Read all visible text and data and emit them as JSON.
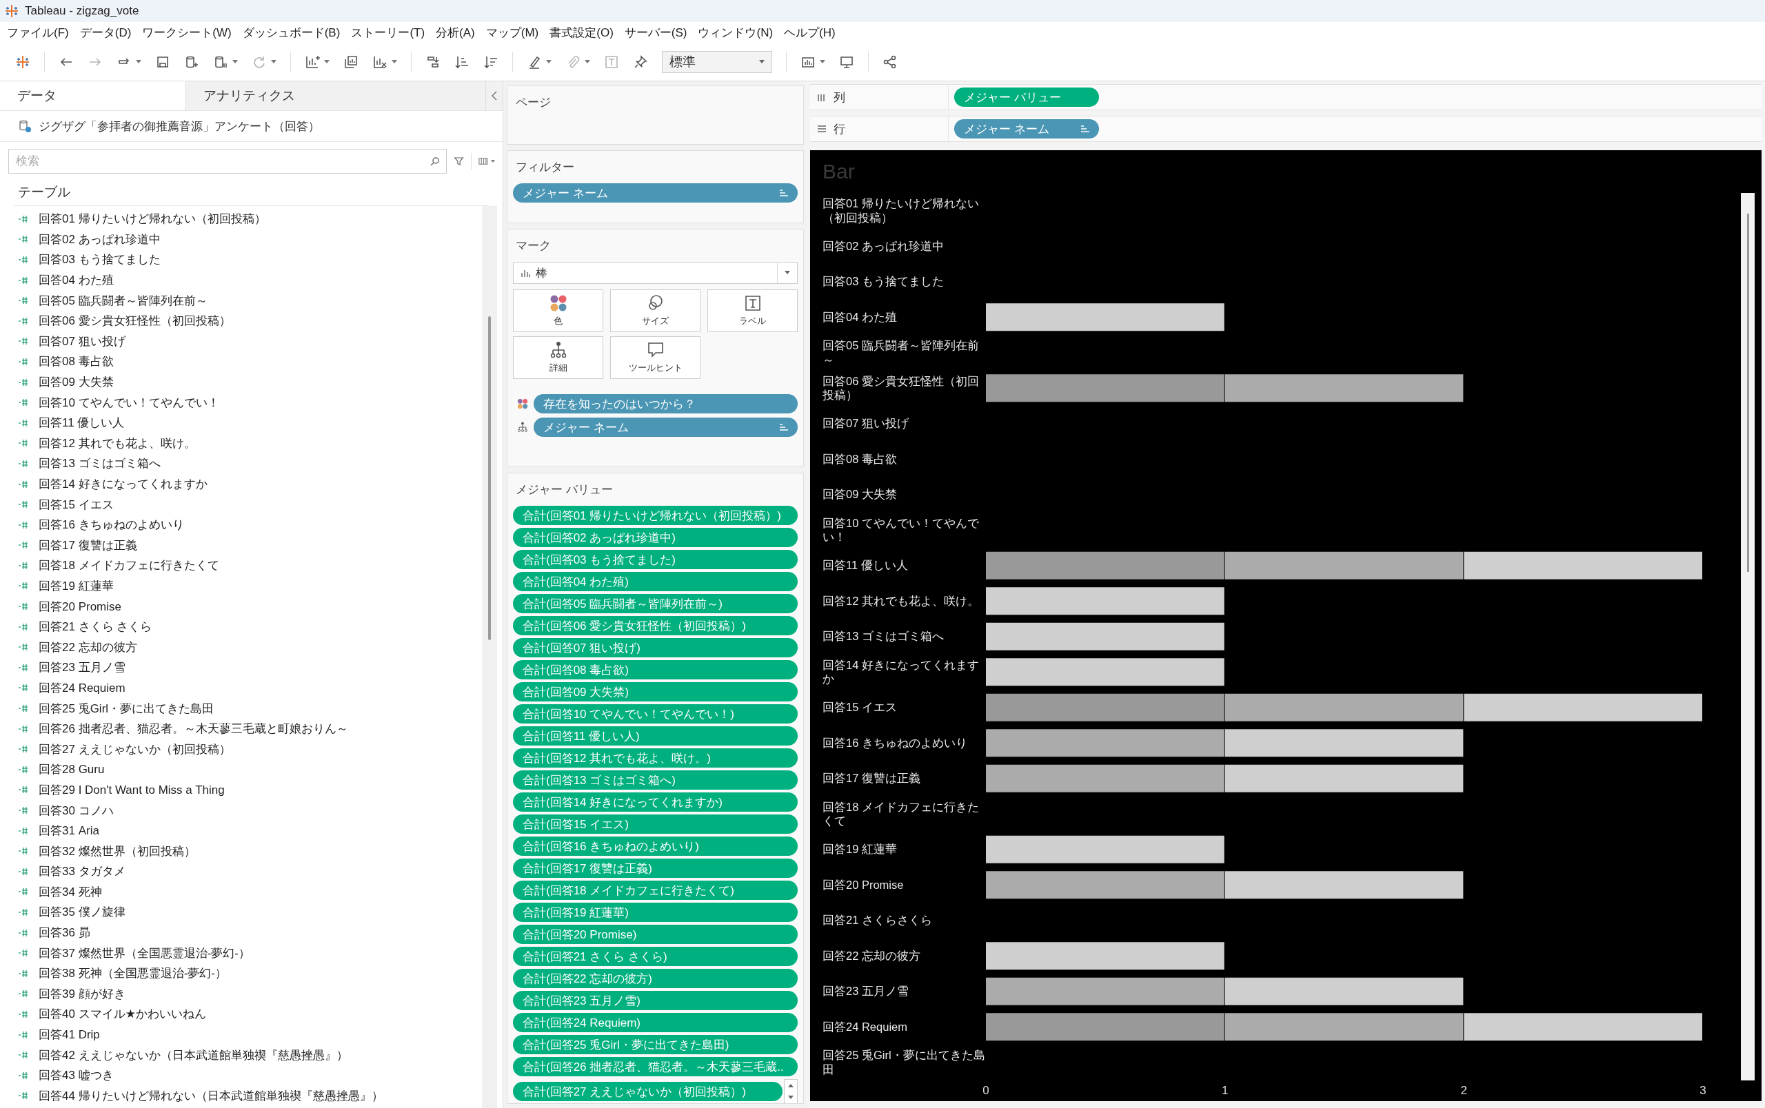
{
  "window": {
    "title": "Tableau - zigzag_vote"
  },
  "menu": [
    "ファイル(F)",
    "データ(D)",
    "ワークシート(W)",
    "ダッシュボード(B)",
    "ストーリー(T)",
    "分析(A)",
    "マップ(M)",
    "書式設定(O)",
    "サーバー(S)",
    "ウィンドウ(N)",
    "ヘルプ(H)"
  ],
  "toolbar": {
    "fit_dropdown": {
      "value": "標準"
    }
  },
  "data_pane": {
    "tabs": [
      {
        "label": "データ",
        "selected": true
      },
      {
        "label": "アナリティクス",
        "selected": false
      }
    ],
    "data_source": "ジグザグ「参拝者の御推薦音源」アンケート（回答）",
    "search": {
      "placeholder": "検索"
    },
    "section": "テーブル",
    "fields": [
      "回答01 帰りたいけど帰れない（初回投稿）",
      "回答02 あっぱれ珍道中",
      "回答03 もう捨てました",
      "回答04 わた殖",
      "回答05 臨兵闘者～皆陣列在前～",
      "回答06 愛シ貴女狂怪性（初回投稿）",
      "回答07 狙い投げ",
      "回答08 毒占欲",
      "回答09 大失禁",
      "回答10 てやんでい！てやんでい！",
      "回答11 優しい人",
      "回答12 其れでも花よ、咲け。",
      "回答13 ゴミはゴミ箱へ",
      "回答14 好きになってくれますか",
      "回答15 イエス",
      "回答16 きちゅねのよめいり",
      "回答17 復讐は正義",
      "回答18 メイドカフェに行きたくて",
      "回答19 紅蓮華",
      "回答20 Promise",
      "回答21 さくら さくら",
      "回答22 忘却の彼方",
      "回答23 五月ノ雪",
      "回答24 Requiem",
      "回答25 兎Girl・夢に出てきた島田",
      "回答26 拙者忍者、猫忍者。～木天蓼三毛蔵と町娘おりん～",
      "回答27 ええじゃないか（初回投稿）",
      "回答28 Guru",
      "回答29 I Don't Want to Miss a Thing",
      "回答30 コノハ",
      "回答31 Aria",
      "回答32 燦然世界（初回投稿）",
      "回答33 タガタメ",
      "回答34 死神",
      "回答35 僕ノ旋律",
      "回答36 昴",
      "回答37 燦然世界（全国悪霊退治-夢幻-）",
      "回答38 死神（全国悪霊退治-夢幻-）",
      "回答39 顔が好き",
      "回答40 スマイル★かわいいねん",
      "回答41 Drip",
      "回答42 ええじゃないか（日本武道館単独禊『慈愚挫愚』）",
      "回答43 嘘つき",
      "回答44 帰りたいけど帰れない（日本武道館単独禊『慈愚挫愚』）"
    ]
  },
  "pages_card": {
    "title": "ページ"
  },
  "filters_card": {
    "title": "フィルター",
    "pills": [
      {
        "label": "メジャー ネーム",
        "kind": "dimension",
        "sorted": true
      }
    ]
  },
  "marks_card": {
    "title": "マーク",
    "mark_type": "棒",
    "buttons": [
      {
        "label": "色",
        "kind": "color"
      },
      {
        "label": "サイズ",
        "kind": "size"
      },
      {
        "label": "ラベル",
        "kind": "label"
      },
      {
        "label": "詳細",
        "kind": "detail"
      },
      {
        "label": "ツールヒント",
        "kind": "tooltip"
      }
    ],
    "pills": [
      {
        "label": "存在を知ったのはいつから？",
        "kind": "color",
        "sorted": false
      },
      {
        "label": "メジャー ネーム",
        "kind": "detail",
        "sorted": true
      }
    ]
  },
  "measure_values_card": {
    "title": "メジャー バリュー",
    "pills": [
      "合計(回答01 帰りたいけど帰れない（初回投稿）)",
      "合計(回答02 あっぱれ珍道中)",
      "合計(回答03 もう捨てました)",
      "合計(回答04 わた殖)",
      "合計(回答05 臨兵闘者～皆陣列在前～)",
      "合計(回答06 愛シ貴女狂怪性（初回投稿）)",
      "合計(回答07 狙い投げ)",
      "合計(回答08 毒占欲)",
      "合計(回答09 大失禁)",
      "合計(回答10 てやんでい！てやんでい！)",
      "合計(回答11 優しい人)",
      "合計(回答12 其れでも花よ、咲け。)",
      "合計(回答13 ゴミはゴミ箱へ)",
      "合計(回答14 好きになってくれますか)",
      "合計(回答15 イエス)",
      "合計(回答16 きちゅねのよめいり)",
      "合計(回答17 復讐は正義)",
      "合計(回答18 メイドカフェに行きたくて)",
      "合計(回答19 紅蓮華)",
      "合計(回答20 Promise)",
      "合計(回答21 さくら さくら)",
      "合計(回答22 忘却の彼方)",
      "合計(回答23 五月ノ雪)",
      "合計(回答24 Requiem)",
      "合計(回答25 兎Girl・夢に出てきた島田)",
      "合計(回答26 拙者忍者、猫忍者。～木天蓼三毛蔵..",
      "合計(回答27 ええじゃないか（初回投稿）)"
    ]
  },
  "shelves": [
    {
      "label": "列",
      "kind": "columns",
      "pill": {
        "label": "メジャー バリュー",
        "kind": "measure",
        "sorted": false
      }
    },
    {
      "label": "行",
      "kind": "rows",
      "pill": {
        "label": "メジャー ネーム",
        "kind": "dimension",
        "sorted": true
      }
    }
  ],
  "view": {
    "chart_data": {
      "type": "bar",
      "title": "Bar",
      "orientation": "horizontal",
      "stacked": true,
      "categories": [
        "回答01 帰りたいけど帰れない（初回投稿）",
        "回答02 あっぱれ珍道中",
        "回答03 もう捨てました",
        "回答04 わた殖",
        "回答05 臨兵闘者～皆陣列在前～",
        "回答06 愛シ貴女狂怪性（初回投稿）",
        "回答07 狙い投げ",
        "回答08 毒占欲",
        "回答09 大失禁",
        "回答10 てやんでい！てやんでい！",
        "回答11 優しい人",
        "回答12 其れでも花よ、咲け。",
        "回答13 ゴミはゴミ箱へ",
        "回答14 好きになってくれますか",
        "回答15 イエス",
        "回答16 きちゅねのよめいり",
        "回答17 復讐は正義",
        "回答18 メイドカフェに行きたくて",
        "回答19 紅蓮華",
        "回答20 Promise",
        "回答21 さくらさくら",
        "回答22 忘却の彼方",
        "回答23 五月ノ雪",
        "回答24 Requiem",
        "回答25 兎Girl・夢に出てきた島田"
      ],
      "series": [
        {
          "color": "#999999",
          "values": [
            null,
            null,
            null,
            null,
            null,
            1,
            null,
            null,
            null,
            null,
            1,
            null,
            null,
            null,
            1,
            null,
            null,
            null,
            null,
            null,
            null,
            null,
            null,
            1,
            null
          ]
        },
        {
          "color": "#ababab",
          "values": [
            null,
            null,
            null,
            null,
            null,
            1,
            null,
            null,
            null,
            null,
            1,
            null,
            null,
            null,
            1,
            1,
            1,
            null,
            null,
            1,
            null,
            null,
            1,
            1,
            null
          ]
        },
        {
          "color": "#cfcfcf",
          "values": [
            null,
            null,
            null,
            1,
            null,
            null,
            null,
            null,
            null,
            null,
            1,
            1,
            1,
            1,
            1,
            1,
            1,
            null,
            1,
            1,
            null,
            1,
            1,
            1,
            null
          ]
        }
      ],
      "xlim": [
        0,
        3
      ],
      "xticks": [
        0,
        1,
        2,
        3
      ]
    }
  }
}
